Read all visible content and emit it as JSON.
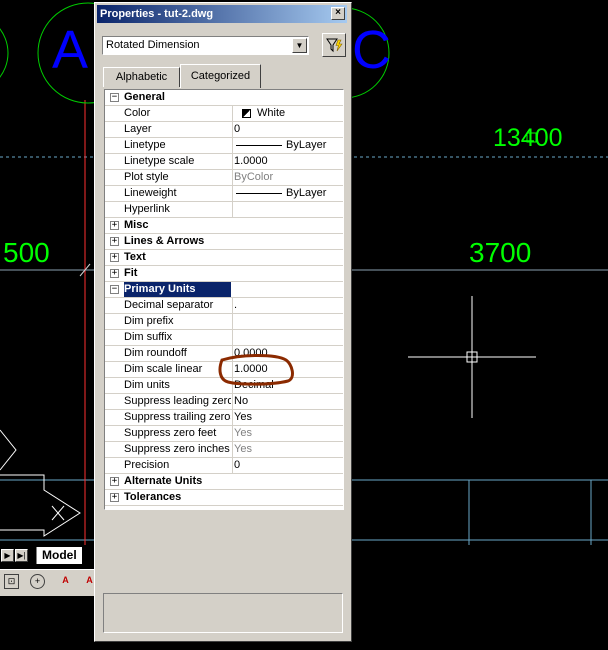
{
  "window": {
    "title": "Properties - tut-2.dwg",
    "close_glyph": "×"
  },
  "object_selector": {
    "value": "Rotated Dimension",
    "arrow_glyph": "▼"
  },
  "quick_select_icon": "funnel-lightning-icon",
  "tabs": [
    {
      "label": "Alphabetic",
      "active": false
    },
    {
      "label": "Categorized",
      "active": true
    }
  ],
  "properties": [
    {
      "kind": "cat",
      "name": "General",
      "expanded": true
    },
    {
      "kind": "prop",
      "name": "Color",
      "value": "White",
      "swatch": true
    },
    {
      "kind": "prop",
      "name": "Layer",
      "value": "0"
    },
    {
      "kind": "prop",
      "name": "Linetype",
      "value": "ByLayer",
      "line": true
    },
    {
      "kind": "prop",
      "name": "Linetype scale",
      "value": "1.0000"
    },
    {
      "kind": "prop",
      "name": "Plot style",
      "value": "ByColor",
      "gray": true
    },
    {
      "kind": "prop",
      "name": "Lineweight",
      "value": "ByLayer",
      "line": true
    },
    {
      "kind": "prop",
      "name": "Hyperlink",
      "value": ""
    },
    {
      "kind": "cat",
      "name": "Misc",
      "expanded": false
    },
    {
      "kind": "cat",
      "name": "Lines & Arrows",
      "expanded": false
    },
    {
      "kind": "cat",
      "name": "Text",
      "expanded": false
    },
    {
      "kind": "cat",
      "name": "Fit",
      "expanded": false
    },
    {
      "kind": "cat",
      "name": "Primary Units",
      "expanded": true,
      "selected": true
    },
    {
      "kind": "prop",
      "name": "Decimal separator",
      "value": "."
    },
    {
      "kind": "prop",
      "name": "Dim prefix",
      "value": ""
    },
    {
      "kind": "prop",
      "name": "Dim suffix",
      "value": ""
    },
    {
      "kind": "prop",
      "name": "Dim roundoff",
      "value": "0.0000"
    },
    {
      "kind": "prop",
      "name": "Dim scale linear",
      "value": "1.0000"
    },
    {
      "kind": "prop",
      "name": "Dim units",
      "value": "Decimal"
    },
    {
      "kind": "prop",
      "name": "Suppress leading zeros",
      "value": "No"
    },
    {
      "kind": "prop",
      "name": "Suppress trailing zeros",
      "value": "Yes"
    },
    {
      "kind": "prop",
      "name": "Suppress zero feet",
      "value": "Yes",
      "gray": true
    },
    {
      "kind": "prop",
      "name": "Suppress zero inches",
      "value": "Yes",
      "gray": true
    },
    {
      "kind": "prop",
      "name": "Precision",
      "value": "0"
    },
    {
      "kind": "cat",
      "name": "Alternate Units",
      "expanded": false
    },
    {
      "kind": "cat",
      "name": "Tolerances",
      "expanded": false
    }
  ],
  "drawing": {
    "letter_a": "A",
    "letter_c": "C",
    "dim_left": "500",
    "dim_right": "3700",
    "dim_top": "13400",
    "annotation_color": "#8b2a00",
    "dim_color": "#00ff00",
    "letter_color": "#0000ff",
    "circle_color": "#00cc00"
  },
  "layout_tabs": {
    "model_label": "Model"
  },
  "colors": {
    "titlebar_start": "#0a246a",
    "titlebar_end": "#a6caf0",
    "selection": "#0a246a",
    "panel": "#d4d0c8"
  }
}
